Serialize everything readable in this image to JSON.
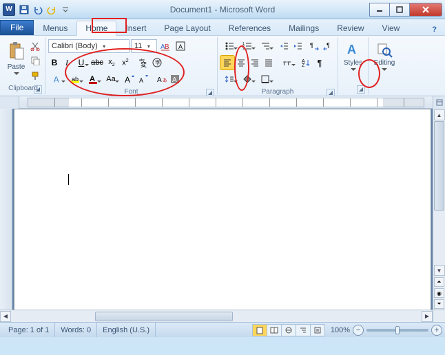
{
  "title": "Document1 - Microsoft Word",
  "qat": {
    "save": "Save",
    "undo": "Undo",
    "redo": "Redo"
  },
  "win": {
    "min": "Minimize",
    "max": "Maximize",
    "close": "Close"
  },
  "tabs": {
    "file": "File",
    "items": [
      "Menus",
      "Home",
      "Insert",
      "Page Layout",
      "References",
      "Mailings",
      "Review",
      "View"
    ],
    "active_index": 1,
    "help": "?"
  },
  "ribbon": {
    "clipboard": {
      "label": "Clipboard",
      "paste": "Paste"
    },
    "font": {
      "label": "Font",
      "name": "Calibri (Body)",
      "size": "11"
    },
    "paragraph": {
      "label": "Paragraph"
    },
    "styles": {
      "label": "Styles",
      "btn": "Styles"
    },
    "editing": {
      "label": "Editing",
      "btn": "Editing"
    }
  },
  "status": {
    "page": "Page: 1 of 1",
    "words": "Words: 0",
    "lang": "English (U.S.)",
    "zoom": "100%"
  }
}
